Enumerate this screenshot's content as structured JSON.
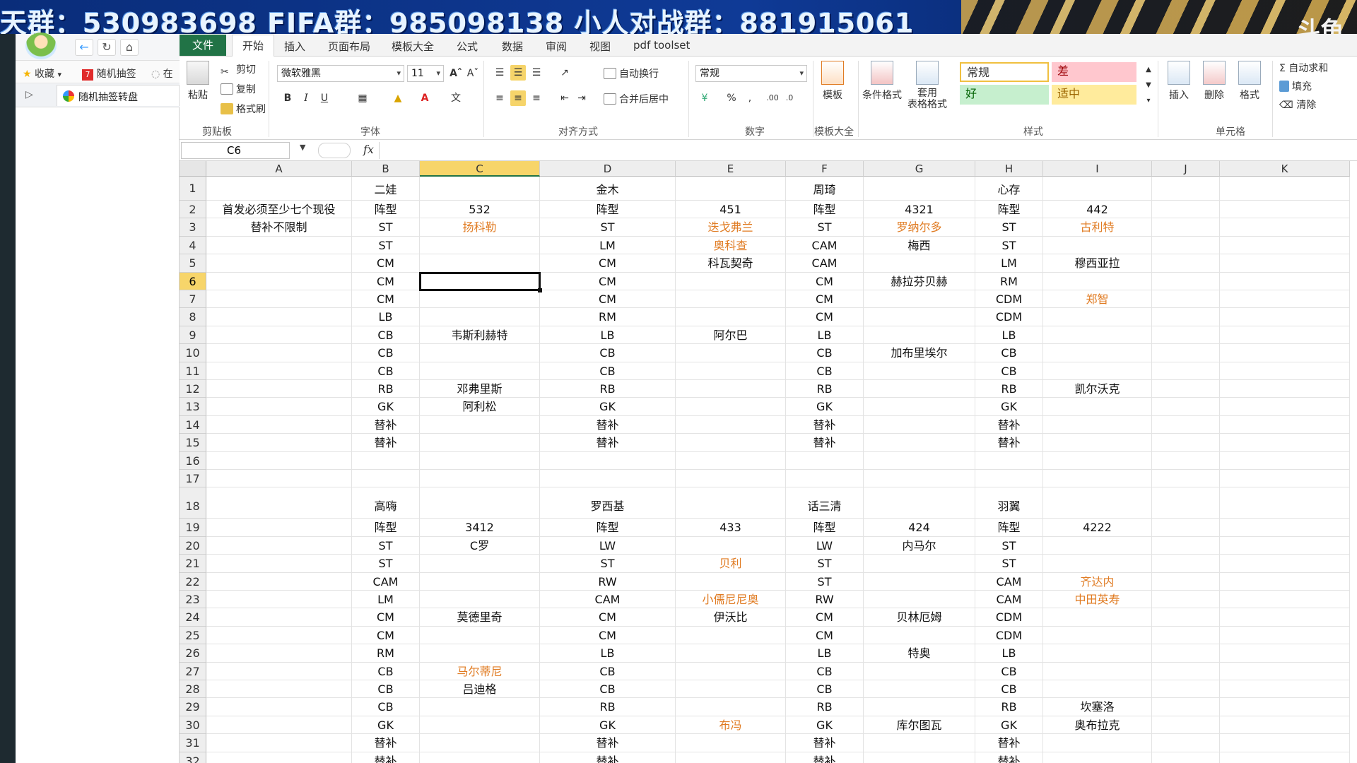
{
  "banner": {
    "text": "天群：530983698   FIFA群：985098138   小人对战群：881915061",
    "logo": "斗鱼"
  },
  "browser": {
    "favorites_label": "收藏",
    "fav_items": [
      "随机抽签",
      "在"
    ],
    "tab_title": "随机抽签转盘"
  },
  "ribbon": {
    "tabs": [
      "文件",
      "开始",
      "插入",
      "页面布局",
      "模板大全",
      "公式",
      "数据",
      "审阅",
      "视图",
      "pdf toolset"
    ],
    "clipboard": {
      "paste": "粘贴",
      "cut": "剪切",
      "copy": "复制",
      "format_painter": "格式刷",
      "label": "剪贴板"
    },
    "font": {
      "name": "微软雅黑",
      "size": "11",
      "label": "字体"
    },
    "align": {
      "wrap": "自动换行",
      "merge": "合并后居中",
      "label": "对齐方式"
    },
    "number": {
      "format": "常规",
      "label": "数字"
    },
    "templates": {
      "btn": "模板",
      "label": "模板大全"
    },
    "styles": {
      "cond_format": "条件格式",
      "table_format": "套用\n表格格式",
      "normal": "常规",
      "bad": "差",
      "good": "好",
      "neutral": "适中",
      "label": "样式"
    },
    "cells": {
      "insert": "插入",
      "delete": "删除",
      "format": "格式",
      "label": "单元格"
    },
    "editing": {
      "autosum": "自动求和",
      "fill": "填充",
      "clear": "清除"
    }
  },
  "colors": {
    "excel_green": "#217346",
    "selected_header": "#f7d56a",
    "orange_text": "#e07b22",
    "banner_blue": "#0f3a96"
  },
  "formula_bar": {
    "name_box": "C6",
    "fx": "fx",
    "content": ""
  },
  "sheet": {
    "columns": [
      "A",
      "B",
      "C",
      "D",
      "E",
      "F",
      "G",
      "H",
      "I",
      "J",
      "K"
    ],
    "selected_column": "C",
    "selected_row": "6",
    "rows": [
      {
        "n": "1",
        "cells": [
          "",
          "二娃",
          "",
          "金木",
          "",
          "周琦",
          "",
          "心存",
          "",
          "",
          ""
        ]
      },
      {
        "n": "2",
        "cells": [
          "首发必须至少七个现役",
          "阵型",
          "532",
          "阵型",
          "451",
          "阵型",
          "4321",
          "阵型",
          "442",
          "",
          ""
        ]
      },
      {
        "n": "3",
        "cells": [
          "替补不限制",
          "ST",
          "扬科勒",
          "ST",
          "迭戈弗兰",
          "ST",
          "罗纳尔多",
          "ST",
          "古利特",
          "",
          ""
        ],
        "orange": [
          2,
          4,
          6,
          8
        ]
      },
      {
        "n": "4",
        "cells": [
          "",
          "ST",
          "",
          "LM",
          "奥科查",
          "CAM",
          "梅西",
          "ST",
          "",
          "",
          ""
        ],
        "orange": [
          4
        ]
      },
      {
        "n": "5",
        "cells": [
          "",
          "CM",
          "",
          "CM",
          "科瓦契奇",
          "CAM",
          "",
          "LM",
          "穆西亚拉",
          "",
          ""
        ]
      },
      {
        "n": "6",
        "cells": [
          "",
          "CM",
          "",
          "CM",
          "",
          "CM",
          "赫拉芬贝赫",
          "RM",
          "",
          "",
          ""
        ]
      },
      {
        "n": "7",
        "cells": [
          "",
          "CM",
          "",
          "CM",
          "",
          "CM",
          "",
          "CDM",
          "郑智",
          "",
          ""
        ],
        "orange": [
          8
        ]
      },
      {
        "n": "8",
        "cells": [
          "",
          "LB",
          "",
          "RM",
          "",
          "CM",
          "",
          "CDM",
          "",
          "",
          ""
        ]
      },
      {
        "n": "9",
        "cells": [
          "",
          "CB",
          "韦斯利赫特",
          "LB",
          "阿尔巴",
          "LB",
          "",
          "LB",
          "",
          "",
          ""
        ]
      },
      {
        "n": "10",
        "cells": [
          "",
          "CB",
          "",
          "CB",
          "",
          "CB",
          "加布里埃尔",
          "CB",
          "",
          "",
          ""
        ]
      },
      {
        "n": "11",
        "cells": [
          "",
          "CB",
          "",
          "CB",
          "",
          "CB",
          "",
          "CB",
          "",
          "",
          ""
        ]
      },
      {
        "n": "12",
        "cells": [
          "",
          "RB",
          "邓弗里斯",
          "RB",
          "",
          "RB",
          "",
          "RB",
          "凯尔沃克",
          "",
          ""
        ]
      },
      {
        "n": "13",
        "cells": [
          "",
          "GK",
          "阿利松",
          "GK",
          "",
          "GK",
          "",
          "GK",
          "",
          "",
          ""
        ]
      },
      {
        "n": "14",
        "cells": [
          "",
          "替补",
          "",
          "替补",
          "",
          "替补",
          "",
          "替补",
          "",
          "",
          ""
        ]
      },
      {
        "n": "15",
        "cells": [
          "",
          "替补",
          "",
          "替补",
          "",
          "替补",
          "",
          "替补",
          "",
          "",
          ""
        ]
      },
      {
        "n": "16",
        "cells": [
          "",
          "",
          "",
          "",
          "",
          "",
          "",
          "",
          "",
          "",
          ""
        ]
      },
      {
        "n": "17",
        "cells": [
          "",
          "",
          "",
          "",
          "",
          "",
          "",
          "",
          "",
          "",
          ""
        ]
      },
      {
        "n": "18",
        "cells": [
          "",
          "高嗨",
          "",
          "罗西基",
          "",
          "话三清",
          "",
          "羽翼",
          "",
          "",
          ""
        ],
        "tall": true
      },
      {
        "n": "19",
        "cells": [
          "",
          "阵型",
          "3412",
          "阵型",
          "433",
          "阵型",
          "424",
          "阵型",
          "4222",
          "",
          ""
        ]
      },
      {
        "n": "20",
        "cells": [
          "",
          "ST",
          "C罗",
          "LW",
          "",
          "LW",
          "内马尔",
          "ST",
          "",
          "",
          ""
        ]
      },
      {
        "n": "21",
        "cells": [
          "",
          "ST",
          "",
          "ST",
          "贝利",
          "ST",
          "",
          "ST",
          "",
          "",
          ""
        ],
        "orange": [
          4
        ]
      },
      {
        "n": "22",
        "cells": [
          "",
          "CAM",
          "",
          "RW",
          "",
          "ST",
          "",
          "CAM",
          "齐达内",
          "",
          ""
        ],
        "orange": [
          8
        ]
      },
      {
        "n": "23",
        "cells": [
          "",
          "LM",
          "",
          "CAM",
          "小儒尼尼奥",
          "RW",
          "",
          "CAM",
          "中田英寿",
          "",
          ""
        ],
        "orange": [
          4,
          8
        ]
      },
      {
        "n": "24",
        "cells": [
          "",
          "CM",
          "莫德里奇",
          "CM",
          "伊沃比",
          "CM",
          "贝林厄姆",
          "CDM",
          "",
          "",
          ""
        ]
      },
      {
        "n": "25",
        "cells": [
          "",
          "CM",
          "",
          "CM",
          "",
          "CM",
          "",
          "CDM",
          "",
          "",
          ""
        ]
      },
      {
        "n": "26",
        "cells": [
          "",
          "RM",
          "",
          "LB",
          "",
          "LB",
          "特奥",
          "LB",
          "",
          "",
          ""
        ]
      },
      {
        "n": "27",
        "cells": [
          "",
          "CB",
          "马尔蒂尼",
          "CB",
          "",
          "CB",
          "",
          "CB",
          "",
          "",
          ""
        ],
        "orange": [
          2
        ]
      },
      {
        "n": "28",
        "cells": [
          "",
          "CB",
          "吕迪格",
          "CB",
          "",
          "CB",
          "",
          "CB",
          "",
          "",
          ""
        ]
      },
      {
        "n": "29",
        "cells": [
          "",
          "CB",
          "",
          "RB",
          "",
          "RB",
          "",
          "RB",
          "坎塞洛",
          "",
          ""
        ]
      },
      {
        "n": "30",
        "cells": [
          "",
          "GK",
          "",
          "GK",
          "布冯",
          "GK",
          "库尔图瓦",
          "GK",
          "奥布拉克",
          "",
          ""
        ],
        "orange": [
          4
        ]
      },
      {
        "n": "31",
        "cells": [
          "",
          "替补",
          "",
          "替补",
          "",
          "替补",
          "",
          "替补",
          "",
          "",
          ""
        ]
      },
      {
        "n": "32",
        "cells": [
          "",
          "替补",
          "",
          "替补",
          "",
          "替补",
          "",
          "替补",
          "",
          "",
          ""
        ]
      }
    ]
  }
}
